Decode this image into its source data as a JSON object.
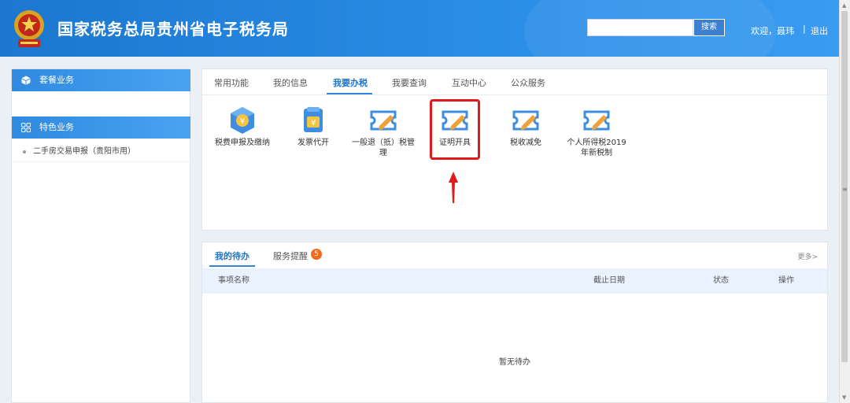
{
  "header": {
    "title": "国家税务总局贵州省电子税务局",
    "search_placeholder": "",
    "search_button": "搜索",
    "welcome": "欢迎，聂玮",
    "separator": "|",
    "logout": "退出"
  },
  "sidebar": {
    "sections": [
      {
        "label": "套餐业务",
        "icon": "cube-icon"
      },
      {
        "label": "特色业务",
        "icon": "grid-icon"
      }
    ],
    "items": [
      {
        "label": "二手房交易申报（贵阳市用）"
      }
    ]
  },
  "top_panel": {
    "tabs": [
      "常用功能",
      "我的信息",
      "我要办税",
      "我要查询",
      "互动中心",
      "公众服务"
    ],
    "active_tab": "我要办税",
    "functions": [
      {
        "label": "税费申报及缴纳",
        "icon": "tax-declare-icon"
      },
      {
        "label": "发票代开",
        "icon": "invoice-icon"
      },
      {
        "label": "一般退（抵）税管理",
        "icon": "edit-ticket-icon"
      },
      {
        "label": "证明开具",
        "icon": "edit-ticket-icon"
      },
      {
        "label": "税收减免",
        "icon": "edit-ticket-icon"
      },
      {
        "label": "个人所得税2019年新税制",
        "icon": "edit-ticket-icon"
      }
    ],
    "highlighted_function": "证明开具"
  },
  "bottom_panel": {
    "tabs": [
      "我的待办",
      "服务提醒"
    ],
    "active_tab": "我的待办",
    "badge": "5",
    "more": "更多>",
    "columns": [
      "事项名称",
      "截止日期",
      "状态",
      "操作"
    ],
    "empty_text": "暂无待办"
  },
  "colors": {
    "header_blue": "#2b8ee6",
    "active_tab": "#1e74c9",
    "highlight_red": "#e01a1a",
    "badge_orange": "#f26b1d"
  }
}
